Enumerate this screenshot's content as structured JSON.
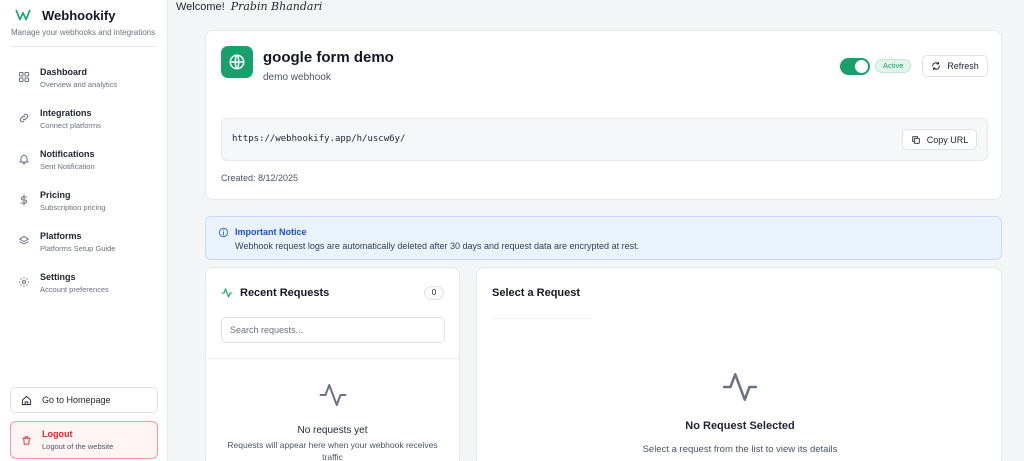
{
  "brand": {
    "name": "Webhookify",
    "tagline": "Manage your webhooks and integrations",
    "accent": "#17a06b"
  },
  "sidebar": {
    "items": [
      {
        "label": "Dashboard",
        "sub": "Overview and analytics",
        "icon": "grid-icon"
      },
      {
        "label": "Integrations",
        "sub": "Connect platforms",
        "icon": "link-icon"
      },
      {
        "label": "Notifications",
        "sub": "Sent Notification",
        "icon": "bell-icon"
      },
      {
        "label": "Pricing",
        "sub": "Subscription pricing",
        "icon": "dollar-icon"
      },
      {
        "label": "Platforms",
        "sub": "Platforms Setup Guide",
        "icon": "layers-icon"
      },
      {
        "label": "Settings",
        "sub": "Account preferences",
        "icon": "gear-icon"
      }
    ],
    "home_label": "Go to Homepage",
    "logout_label": "Logout",
    "logout_sub": "Logout of the website"
  },
  "header": {
    "welcome": "Welcome!",
    "user_name": "Prabin Bhandari"
  },
  "webhook": {
    "title": "google form demo",
    "description": "demo webhook",
    "enabled": true,
    "status": "Active",
    "refresh_label": "Refresh",
    "url": "https://webhookify.app/h/uscw6y/",
    "copy_label": "Copy URL",
    "created": "Created: 8/12/2025"
  },
  "notice": {
    "title": "Important Notice",
    "text": "Webhook request logs are automatically deleted after 30 days and request data are encrypted at rest."
  },
  "requests": {
    "title": "Recent Requests",
    "count": "0",
    "search_placeholder": "Search requests...",
    "empty_title": "No requests yet",
    "empty_sub": "Requests will appear here when your webhook receives traffic"
  },
  "detail": {
    "title": "Select a Request",
    "empty_title": "No Request Selected",
    "empty_sub": "Select a request from the list to view its details"
  }
}
